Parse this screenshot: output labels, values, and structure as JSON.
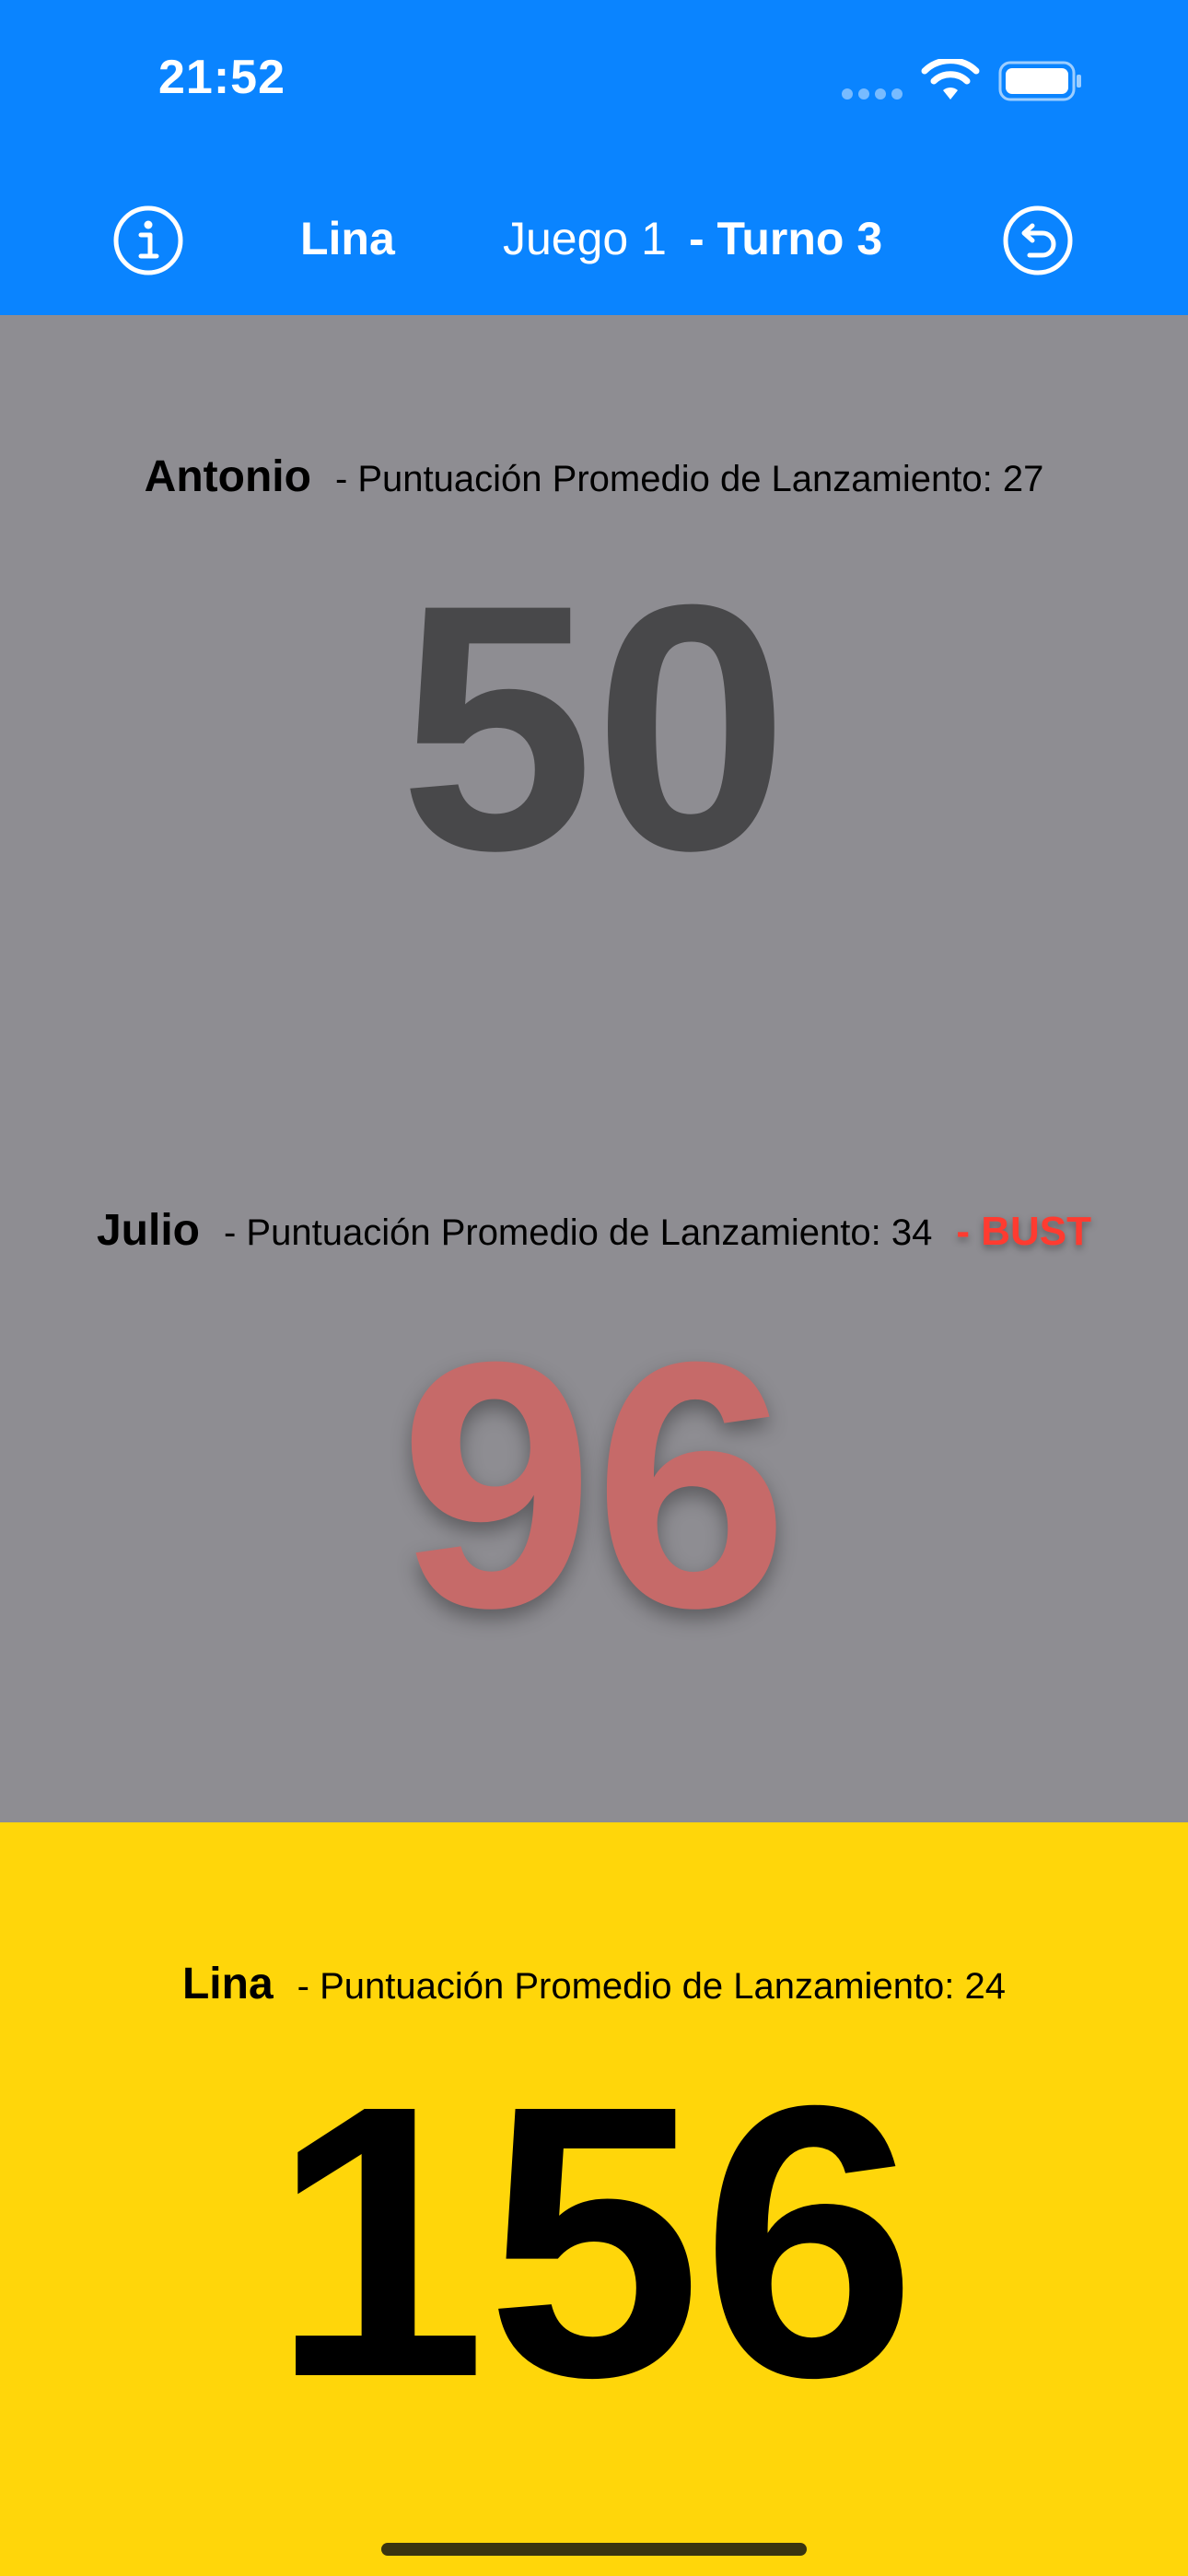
{
  "status_bar": {
    "time": "21:52",
    "wifi_icon": "wifi-icon",
    "battery_icon": "battery-icon"
  },
  "nav_bar": {
    "info_icon": "info-circle-icon",
    "current_player": "Lina",
    "game_label": "Juego 1",
    "turn_label": "- Turno 3",
    "undo_icon": "undo-circle-icon",
    "background_color": "#0a84ff"
  },
  "players": [
    {
      "name": "Antonio",
      "average_text": "- Puntuación Promedio de Lanzamiento: 27",
      "score": "50",
      "bust": "",
      "panel_color": "#8e8d92",
      "score_color": "#48484a"
    },
    {
      "name": "Julio",
      "average_text": "- Puntuación Promedio de Lanzamiento: 34",
      "score": "96",
      "bust": "- BUST",
      "panel_color": "#8e8d92",
      "score_color": "#c66a69"
    },
    {
      "name": "Lina",
      "average_text": "- Puntuación Promedio de Lanzamiento: 24",
      "score": "156",
      "bust": "",
      "panel_color": "#ffd60a",
      "score_color": "#000000"
    }
  ]
}
